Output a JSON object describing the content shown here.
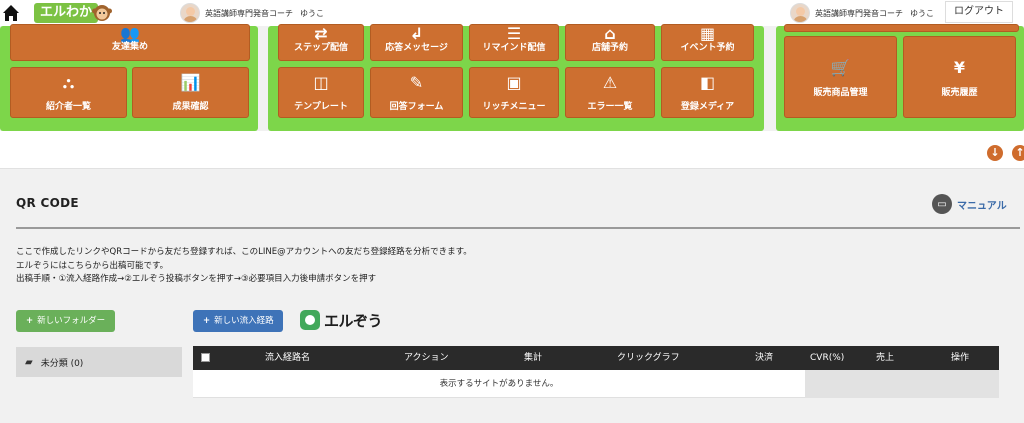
{
  "topbar": {
    "brand": "エルわか",
    "left_user_title": "英語講師専門発音コーチ",
    "left_user_name": "ゆうこ",
    "right_user_title": "英語講師専門発音コーチ",
    "right_user_name": "ゆうこ",
    "logout_label": "ログアウト"
  },
  "menu": {
    "group1": [
      {
        "label": "友達集め",
        "icon": "people-icon",
        "glyph": "👥"
      },
      {
        "label": "紹介者一覧",
        "icon": "referral-icon",
        "glyph": "⛬"
      },
      {
        "label": "成果確認",
        "icon": "presentation-icon",
        "glyph": "📊"
      }
    ],
    "group2": [
      {
        "label": "ステップ配信",
        "icon": "shuffle-icon",
        "glyph": "⇄"
      },
      {
        "label": "応答メッセージ",
        "icon": "reply-icon",
        "glyph": "↲"
      },
      {
        "label": "リマインド配信",
        "icon": "list-icon",
        "glyph": "☰"
      },
      {
        "label": "店舗予約",
        "icon": "store-icon",
        "glyph": "⌂"
      },
      {
        "label": "イベント予約",
        "icon": "calendar-icon",
        "glyph": "▦"
      },
      {
        "label": "テンプレート",
        "icon": "columns-icon",
        "glyph": "◫"
      },
      {
        "label": "回答フォーム",
        "icon": "form-icon",
        "glyph": "✎"
      },
      {
        "label": "リッチメニュー",
        "icon": "image-icon",
        "glyph": "▣"
      },
      {
        "label": "エラー一覧",
        "icon": "warning-icon",
        "glyph": "⚠"
      },
      {
        "label": "登録メディア",
        "icon": "media-icon",
        "glyph": "◧"
      }
    ],
    "group3": [
      {
        "label": "販売商品管理",
        "icon": "cart-icon",
        "glyph": "🛒"
      },
      {
        "label": "販売履歴",
        "icon": "money-bag-icon",
        "glyph": "¥"
      }
    ]
  },
  "page": {
    "title": "QR CODE",
    "manual_label": "マニュアル",
    "desc_line1": "ここで作成したリンクやQRコードから友だち登録すれば、このLINE@アカウントへの友だち登録経路を分析できます。",
    "desc_line2": "エルぞうにはこちらから出稿可能です。",
    "desc_line3": "出稿手順・①流入経路作成→②エルぞう投稿ボタンを押す→③必要項目入力後申請ボタンを押す",
    "new_folder_label": "新しいフォルダー",
    "new_route_label": "新しい流入経路",
    "erzou_logo": "エルぞう",
    "folder_label": "未分類 (0)"
  },
  "table": {
    "headers": [
      "流入経路名",
      "アクション",
      "集計",
      "クリックグラフ",
      "決済",
      "CVR(%)",
      "売上",
      "操作"
    ],
    "empty_message": "表示するサイトがありません。"
  },
  "colors": {
    "panel_green": "#7dd64a",
    "tile_orange": "#cd6f30",
    "brand_green": "#7cc243",
    "button_green": "#6ab05a",
    "button_blue": "#3e73b8",
    "table_header": "#2a2a2a"
  }
}
